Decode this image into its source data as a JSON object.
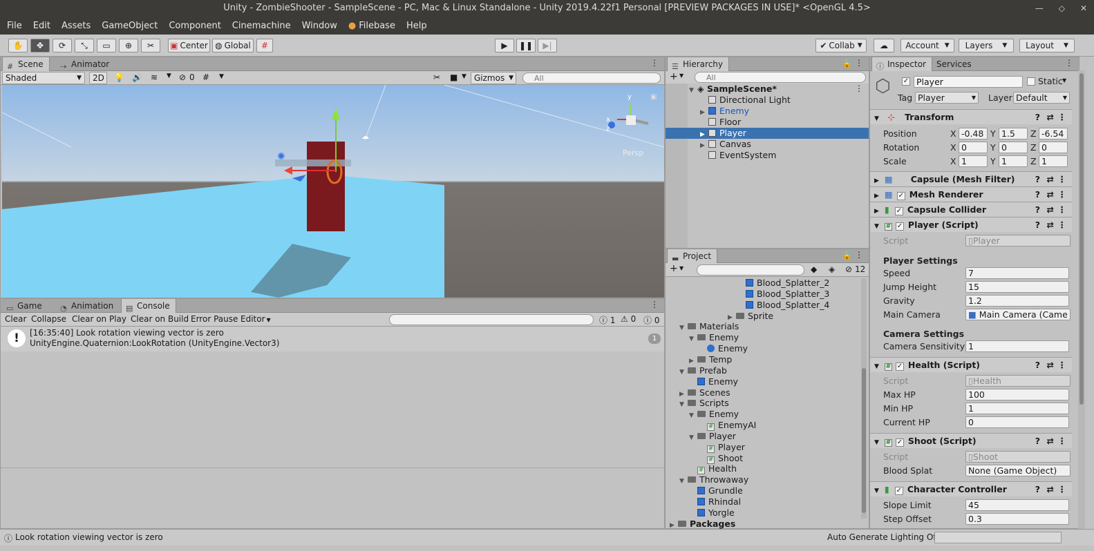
{
  "window": {
    "title": "Unity - ZombieShooter - SampleScene - PC, Mac & Linux Standalone - Unity 2019.4.22f1 Personal [PREVIEW PACKAGES IN USE]* <OpenGL 4.5>"
  },
  "menu": [
    "File",
    "Edit",
    "Assets",
    "GameObject",
    "Component",
    "Cinemachine",
    "Window",
    "Filebase",
    "Help"
  ],
  "toolbar": {
    "center": "Center",
    "global": "Global",
    "collab": "Collab",
    "account": "Account",
    "layers": "Layers",
    "layout": "Layout"
  },
  "scene": {
    "tabs": [
      "Scene",
      "Animator"
    ],
    "shading": "Shaded",
    "mode2d": "2D",
    "hidden_count": "0",
    "gizmos": "Gizmos",
    "search_placeholder": "All",
    "persp": "Persp",
    "axis_labels": {
      "y": "y",
      "x": "x",
      "z": "z"
    }
  },
  "console": {
    "tabs": [
      "Game",
      "Animation",
      "Console"
    ],
    "buttons": [
      "Clear",
      "Collapse",
      "Clear on Play",
      "Clear on Build",
      "Error Pause",
      "Editor"
    ],
    "counts": {
      "info": "1",
      "warn": "0",
      "error": "0"
    },
    "message_line1": "[16:35:40] Look rotation viewing vector is zero",
    "message_line2": "UnityEngine.Quaternion:LookRotation (UnityEngine.Vector3)",
    "message_count": "1"
  },
  "hierarchy": {
    "tab": "Hierarchy",
    "search_placeholder": "All",
    "scene": "SampleScene*",
    "items": [
      {
        "label": "Directional Light",
        "indent": 1,
        "arrow": "",
        "blue": false
      },
      {
        "label": "Enemy",
        "indent": 1,
        "arrow": "▶",
        "blue": true
      },
      {
        "label": "Floor",
        "indent": 1,
        "arrow": "",
        "blue": false
      },
      {
        "label": "Player",
        "indent": 1,
        "arrow": "▶",
        "blue": false,
        "selected": true
      },
      {
        "label": "Canvas",
        "indent": 1,
        "arrow": "▶",
        "blue": false
      },
      {
        "label": "EventSystem",
        "indent": 1,
        "arrow": "",
        "blue": false
      }
    ]
  },
  "project": {
    "tab": "Project",
    "hidden_count": "12",
    "items": [
      {
        "label": "Blood_Splatter_2",
        "depth": 7,
        "arrow": "",
        "icon": "prefab"
      },
      {
        "label": "Blood_Splatter_3",
        "depth": 7,
        "arrow": "",
        "icon": "prefab"
      },
      {
        "label": "Blood_Splatter_4",
        "depth": 7,
        "arrow": "",
        "icon": "prefab"
      },
      {
        "label": "Sprite",
        "depth": 6,
        "arrow": "▶",
        "icon": "folder"
      },
      {
        "label": "Materials",
        "depth": 1,
        "arrow": "▼",
        "icon": "folder"
      },
      {
        "label": "Enemy",
        "depth": 2,
        "arrow": "▼",
        "icon": "folder"
      },
      {
        "label": "Enemy",
        "depth": 3,
        "arrow": "",
        "icon": "material"
      },
      {
        "label": "Temp",
        "depth": 2,
        "arrow": "▶",
        "icon": "folder"
      },
      {
        "label": "Prefab",
        "depth": 1,
        "arrow": "▼",
        "icon": "folder"
      },
      {
        "label": "Enemy",
        "depth": 2,
        "arrow": "",
        "icon": "prefab"
      },
      {
        "label": "Scenes",
        "depth": 1,
        "arrow": "▶",
        "icon": "folder"
      },
      {
        "label": "Scripts",
        "depth": 1,
        "arrow": "▼",
        "icon": "folder"
      },
      {
        "label": "Enemy",
        "depth": 2,
        "arrow": "▼",
        "icon": "folder"
      },
      {
        "label": "EnemyAI",
        "depth": 3,
        "arrow": "",
        "icon": "script"
      },
      {
        "label": "Player",
        "depth": 2,
        "arrow": "▼",
        "icon": "folder"
      },
      {
        "label": "Player",
        "depth": 3,
        "arrow": "",
        "icon": "script"
      },
      {
        "label": "Shoot",
        "depth": 3,
        "arrow": "",
        "icon": "script"
      },
      {
        "label": "Health",
        "depth": 2,
        "arrow": "",
        "icon": "script"
      },
      {
        "label": "Throwaway",
        "depth": 1,
        "arrow": "▼",
        "icon": "folder"
      },
      {
        "label": "Grundle",
        "depth": 2,
        "arrow": "",
        "icon": "prefab"
      },
      {
        "label": "Rhindal",
        "depth": 2,
        "arrow": "",
        "icon": "prefab"
      },
      {
        "label": "Yorgle",
        "depth": 2,
        "arrow": "",
        "icon": "prefab"
      },
      {
        "label": "Packages",
        "depth": 0,
        "arrow": "▶",
        "icon": "folder",
        "bold": true
      }
    ]
  },
  "inspector": {
    "tabs": [
      "Inspector",
      "Services"
    ],
    "name": "Player",
    "static_label": "Static",
    "tag_label": "Tag",
    "tag": "Player",
    "layer_label": "Layer",
    "layer": "Default",
    "transform": {
      "title": "Transform",
      "rows": [
        {
          "label": "Position",
          "x": "-0.48",
          "y": "1.5",
          "z": "-6.54"
        },
        {
          "label": "Rotation",
          "x": "0",
          "y": "0",
          "z": "0"
        },
        {
          "label": "Scale",
          "x": "1",
          "y": "1",
          "z": "1"
        }
      ]
    },
    "components": {
      "mesh_filter": "Capsule (Mesh Filter)",
      "mesh_renderer": "Mesh Renderer",
      "capsule_collider": "Capsule Collider",
      "player_script": "Player (Script)",
      "health_script": "Health (Script)",
      "shoot_script": "Shoot (Script)",
      "char_controller": "Character Controller"
    },
    "player": {
      "script_label": "Script",
      "script": "Player",
      "settings_header": "Player Settings",
      "speed_label": "Speed",
      "speed": "7",
      "jump_label": "Jump Height",
      "jump": "15",
      "gravity_label": "Gravity",
      "gravity": "1.2",
      "camera_label": "Main Camera",
      "camera": "Main Camera (Came",
      "cam_header": "Camera Settings",
      "sens_label": "Camera Sensitivity",
      "sens": "1"
    },
    "health": {
      "script_label": "Script",
      "script": "Health",
      "max_label": "Max HP",
      "max": "100",
      "min_label": "Min HP",
      "min": "1",
      "cur_label": "Current HP",
      "cur": "0"
    },
    "shoot": {
      "script_label": "Script",
      "script": "Shoot",
      "splat_label": "Blood Splat",
      "splat": "None (Game Object)"
    },
    "cc": {
      "slope_label": "Slope Limit",
      "slope": "45",
      "step_label": "Step Offset",
      "step": "0.3"
    }
  },
  "status": {
    "message": "Look rotation viewing vector is zero",
    "lighting": "Auto Generate Lighting Off"
  }
}
